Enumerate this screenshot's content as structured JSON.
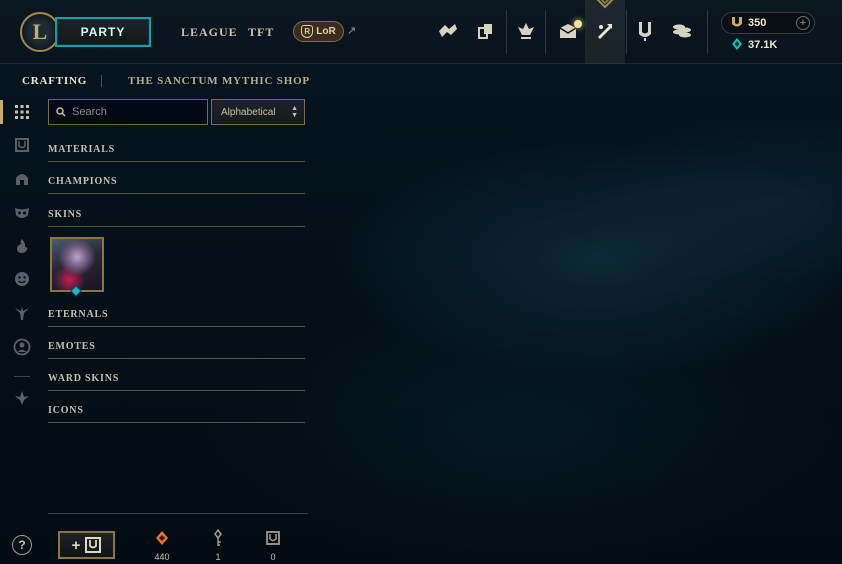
{
  "topbar": {
    "party_label": "PARTY",
    "nav": [
      "LEAGUE",
      "TFT"
    ],
    "lor_label": "LoR",
    "currency": {
      "rp": "350",
      "be": "37.1K"
    },
    "icons": [
      "challenges-icon",
      "collection-icon",
      "tft-icon",
      "store-icon",
      "loot-icon",
      "wallet-icon",
      "coins-icon"
    ]
  },
  "subnav": {
    "tabs": [
      "CRAFTING",
      "THE SANCTUM",
      "MYTHIC SHOP"
    ],
    "active": "CRAFTING"
  },
  "sidebar": {
    "icons": [
      "grid-icon",
      "chest-icon",
      "champion-helmet-icon",
      "skin-mask-icon",
      "fire-icon",
      "emote-icon",
      "ward-icon",
      "profile-icon",
      "tft-crest-icon"
    ]
  },
  "filters": {
    "search_placeholder": "Search",
    "sort_value": "Alphabetical"
  },
  "categories": {
    "materials": "MATERIALS",
    "champions": "CHAMPIONS",
    "skins": "SKINS",
    "eternals": "ETERNALS",
    "emotes": "EMOTES",
    "ward_skins": "WARD SKINS",
    "icons": "ICONS"
  },
  "bottom": {
    "add_label": "+",
    "orange_essence": "440",
    "keys": "1",
    "chests": "0"
  },
  "help_label": "?"
}
